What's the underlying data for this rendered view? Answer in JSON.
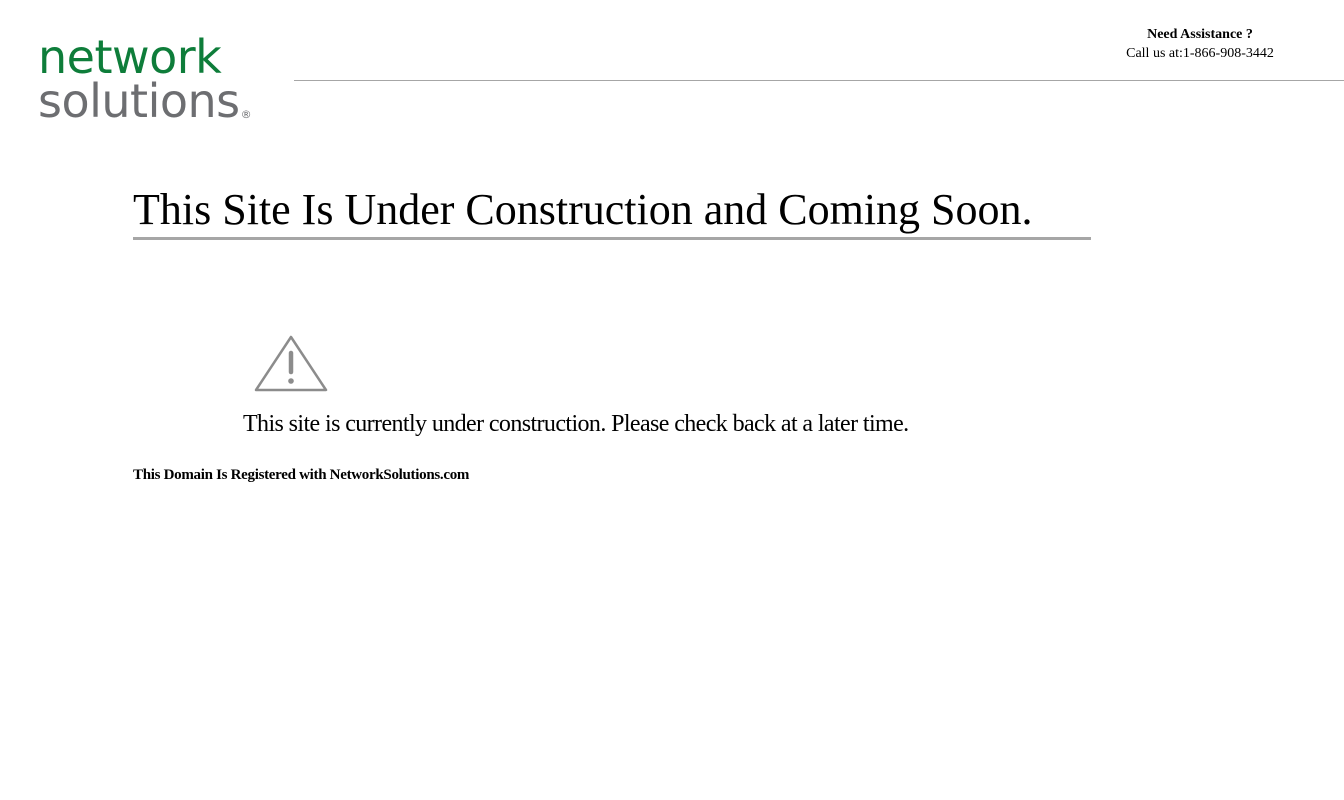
{
  "brand": {
    "line1": "network",
    "line2": "solutions",
    "registered_mark": "®",
    "primary_color": "#0e7d3a",
    "secondary_color": "#6d6e71"
  },
  "assistance": {
    "title": "Need Assistance ?",
    "phone_label": "Call us at:1-866-908-3442"
  },
  "main": {
    "headline": "This Site Is Under Construction and Coming Soon.",
    "warning_icon": "warning-triangle-icon",
    "notice": "This site is currently under construction. Please check back at a later time.",
    "registered_note": "This Domain Is Registered with NetworkSolutions.com"
  },
  "colors": {
    "rule": "#a6a6a6",
    "icon_stroke": "#8c8c8c"
  }
}
